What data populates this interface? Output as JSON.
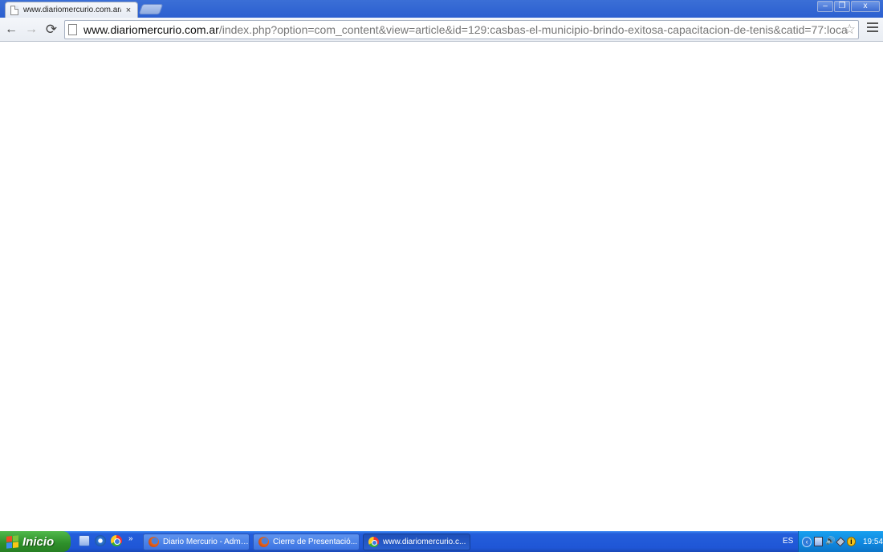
{
  "browser": {
    "tab": {
      "title": "www.diariomercurio.com.ar/i",
      "close_glyph": "×"
    },
    "window_controls": {
      "minimize": "–",
      "maximize": "❐",
      "close": "x"
    },
    "toolbar": {
      "back_glyph": "←",
      "forward_glyph": "→",
      "reload_glyph": "⟳",
      "url_host": "www.diariomercurio.com.ar",
      "url_path": "/index.php?option=com_content&view=article&id=129:casbas-el-municipio-brindo-exitosa-capacitacion-de-tenis&catid=77:loca",
      "bookmark_glyph": "☆"
    }
  },
  "taskbar": {
    "start_label": "Inicio",
    "quick_launch_more": "»",
    "tasks": [
      {
        "label": "Diario Mercurio - Admi...",
        "icon": "firefox-icon",
        "active": false
      },
      {
        "label": "Cierre de Presentació...",
        "icon": "firefox-icon",
        "active": false
      },
      {
        "label": "www.diariomercurio.c...",
        "icon": "chrome-icon",
        "active": true
      }
    ],
    "language": "ES",
    "tray_arrow": "‹",
    "clock": "19:54"
  },
  "colors": {
    "taskbar_blue": "#245edb",
    "start_green": "#2e8f2a",
    "tray_blue": "#0f86de"
  }
}
